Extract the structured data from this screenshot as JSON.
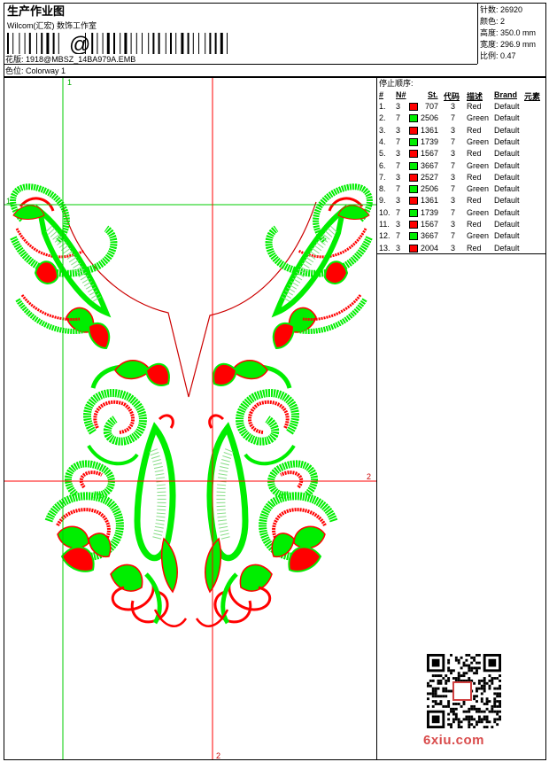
{
  "header": {
    "title": "生产作业图",
    "subtitle": "Wilcom(汇宏) 数饰工作室",
    "barcode_glyph": "@",
    "design_label": "花版:",
    "design_file": "1918@MBSZ_14BA979A.EMB",
    "colorway_label": "色位:",
    "colorway": "Colorway 1"
  },
  "specs": [
    {
      "label": "针数:",
      "value": "26920"
    },
    {
      "label": "颜色:",
      "value": "2"
    },
    {
      "label": "高度:",
      "value": "350.0 mm"
    },
    {
      "label": "宽度:",
      "value": "296.9 mm"
    },
    {
      "label": "比例:",
      "value": "0.47"
    }
  ],
  "design": {
    "markers": {
      "top": "1",
      "left": "1",
      "right": "2",
      "bottom": "2"
    }
  },
  "stop_list": {
    "title": "停止顺序:",
    "columns": [
      "#",
      "N#",
      "St.",
      "代码",
      "描述",
      "Brand",
      "元素"
    ],
    "rows": [
      {
        "idx": "1.",
        "needle": "3",
        "color": "#ff0000",
        "stitches": "707",
        "code": "3",
        "desc": "Red",
        "brand": "Default"
      },
      {
        "idx": "2.",
        "needle": "7",
        "color": "#00ee00",
        "stitches": "2506",
        "code": "7",
        "desc": "Green",
        "brand": "Default"
      },
      {
        "idx": "3.",
        "needle": "3",
        "color": "#ff0000",
        "stitches": "1361",
        "code": "3",
        "desc": "Red",
        "brand": "Default"
      },
      {
        "idx": "4.",
        "needle": "7",
        "color": "#00ee00",
        "stitches": "1739",
        "code": "7",
        "desc": "Green",
        "brand": "Default"
      },
      {
        "idx": "5.",
        "needle": "3",
        "color": "#ff0000",
        "stitches": "1567",
        "code": "3",
        "desc": "Red",
        "brand": "Default"
      },
      {
        "idx": "6.",
        "needle": "7",
        "color": "#00ee00",
        "stitches": "3667",
        "code": "7",
        "desc": "Green",
        "brand": "Default"
      },
      {
        "idx": "7.",
        "needle": "3",
        "color": "#ff0000",
        "stitches": "2527",
        "code": "3",
        "desc": "Red",
        "brand": "Default"
      },
      {
        "idx": "8.",
        "needle": "7",
        "color": "#00ee00",
        "stitches": "2506",
        "code": "7",
        "desc": "Green",
        "brand": "Default"
      },
      {
        "idx": "9.",
        "needle": "3",
        "color": "#ff0000",
        "stitches": "1361",
        "code": "3",
        "desc": "Red",
        "brand": "Default"
      },
      {
        "idx": "10.",
        "needle": "7",
        "color": "#00ee00",
        "stitches": "1739",
        "code": "7",
        "desc": "Green",
        "brand": "Default"
      },
      {
        "idx": "11.",
        "needle": "3",
        "color": "#ff0000",
        "stitches": "1567",
        "code": "3",
        "desc": "Red",
        "brand": "Default"
      },
      {
        "idx": "12.",
        "needle": "7",
        "color": "#00ee00",
        "stitches": "3667",
        "code": "7",
        "desc": "Green",
        "brand": "Default"
      },
      {
        "idx": "13.",
        "needle": "3",
        "color": "#ff0000",
        "stitches": "2004",
        "code": "3",
        "desc": "Red",
        "brand": "Default"
      }
    ]
  },
  "watermark": {
    "text": "6xiu.com"
  },
  "colors": {
    "red": "#ff0000",
    "green": "#00ee00",
    "guide_green": "#00cc00",
    "guide_red": "#ff0000",
    "outline": "#cc0000"
  }
}
